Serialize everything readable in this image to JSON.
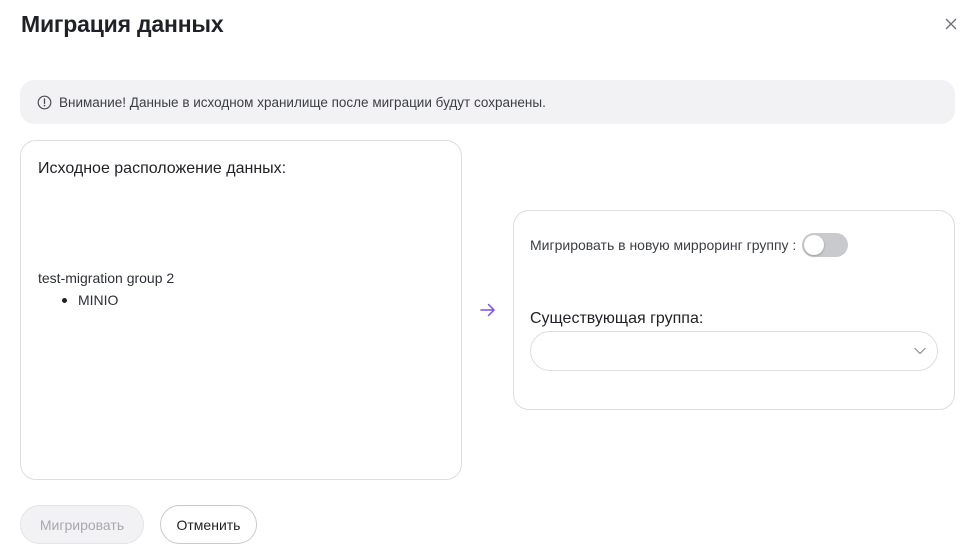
{
  "dialog": {
    "title": "Миграция данных",
    "close_icon": "close-icon"
  },
  "alert": {
    "icon": "info-circle-icon",
    "text": "Внимание! Данные в исходном хранилище после миграции будут сохранены."
  },
  "source": {
    "title": "Исходное расположение данных:",
    "group_name": "test-migration group 2",
    "storages": [
      {
        "label": "MINIO"
      }
    ]
  },
  "arrow_icon": "arrow-right-icon",
  "destination": {
    "new_group_toggle_label": "Мигрировать в новую мирроринг группу :",
    "new_group_toggle_on": false,
    "existing_group_label": "Существующая группа:",
    "existing_group_value": "",
    "chevron_icon": "chevron-down-icon"
  },
  "actions": {
    "migrate_label": "Мигрировать",
    "migrate_disabled": true,
    "cancel_label": "Отменить"
  },
  "colors": {
    "accent": "#7b4ff0",
    "alert_bg": "#f2f2f4",
    "border": "#dcdde1",
    "toggle_off": "#c9cacd"
  }
}
